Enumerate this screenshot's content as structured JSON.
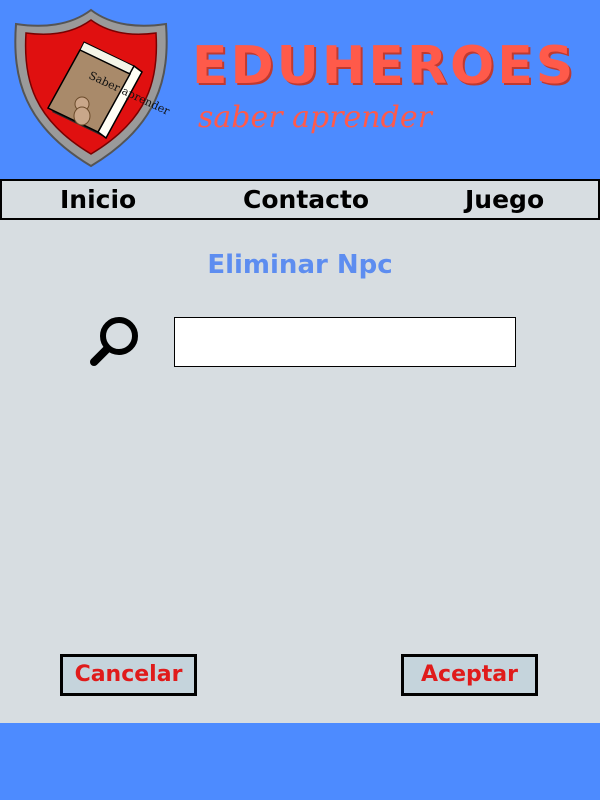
{
  "brand": {
    "title": "EDUHEROES",
    "subtitle": "saber aprender",
    "logo_book_text": "Saber aprender",
    "logo_icon": "shield-book-icon"
  },
  "nav": {
    "items": [
      {
        "label": "Inicio"
      },
      {
        "label": "Contacto"
      },
      {
        "label": "Juego"
      }
    ]
  },
  "main": {
    "title": "Eliminar Npc",
    "search": {
      "value": "",
      "placeholder": "",
      "icon": "search-icon"
    }
  },
  "buttons": {
    "cancel_label": "Cancelar",
    "accept_label": "Aceptar"
  },
  "colors": {
    "header_bg": "#4d8bff",
    "content_bg": "#d7dde1",
    "brand_red": "#ff5a4a",
    "button_text": "#e01b1b",
    "title_blue": "#5d8df0"
  }
}
